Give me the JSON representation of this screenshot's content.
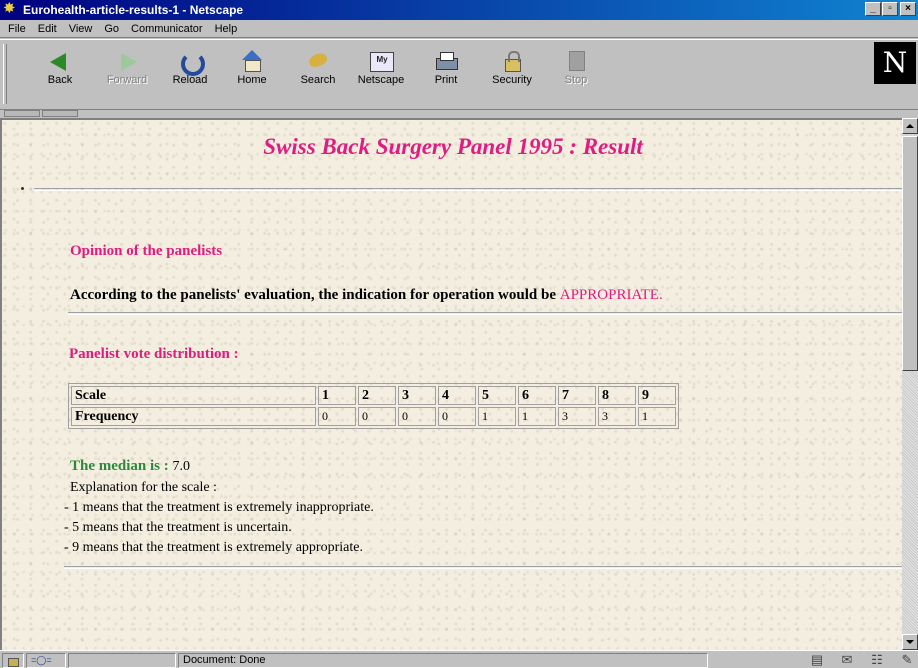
{
  "window": {
    "title": "Eurohealth-article-results-1 - Netscape"
  },
  "menu": [
    "File",
    "Edit",
    "View",
    "Go",
    "Communicator",
    "Help"
  ],
  "toolbar": {
    "back": "Back",
    "forward": "Forward",
    "reload": "Reload",
    "home": "Home",
    "search": "Search",
    "netscape": "Netscape",
    "print": "Print",
    "security": "Security",
    "stop": "Stop",
    "brand": "N"
  },
  "page": {
    "title": "Swiss Back Surgery Panel 1995 : Result",
    "opinion_heading": "Opinion of the panelists",
    "verdict_text": "According to the panelists' evaluation, the indication for operation would be ",
    "verdict_value": "APPROPRIATE.",
    "distribution_heading": "Panelist vote distribution :",
    "table": {
      "scale_label": "Scale",
      "frequency_label": "Frequency",
      "scale": [
        "1",
        "2",
        "3",
        "4",
        "5",
        "6",
        "7",
        "8",
        "9"
      ],
      "frequency": [
        "0",
        "0",
        "0",
        "0",
        "1",
        "1",
        "3",
        "3",
        "1"
      ]
    },
    "median_label": "The median is : ",
    "median_value": "7.0",
    "explanation_title": "Explanation for the scale :",
    "explanations": [
      "- 1 means that the treatment is extremely inappropriate.",
      "- 5 means that the treatment is uncertain.",
      "- 9 means that the treatment is extremely appropriate."
    ]
  },
  "status": {
    "text": "Document: Done"
  }
}
